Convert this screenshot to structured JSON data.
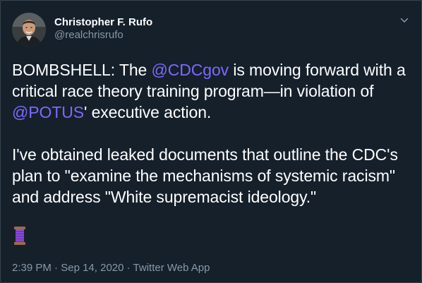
{
  "author": {
    "name": "Christopher F. Rufo",
    "handle": "@realchrisrufo"
  },
  "tweet": {
    "p1": {
      "t1": "BOMBSHELL: The ",
      "m1": "@CDCgov",
      "t2": " is moving forward with a critical race theory training program—in violation of ",
      "m2": "@POTUS",
      "t3": "' executive action."
    },
    "p2": "I've obtained leaked documents that outline the CDC's plan to \"examine the mechanisms of systemic racism\" and address \"White supremacist ideology.\"",
    "emoji_icon": "thread-spool-icon"
  },
  "meta": {
    "time": "2:39 PM",
    "separator1": " · ",
    "date": "Sep 14, 2020",
    "separator2": " · ",
    "source": "Twitter Web App"
  },
  "colors": {
    "background": "#15202b",
    "mention": "#7f68ff",
    "secondary_text": "#8899a6"
  }
}
